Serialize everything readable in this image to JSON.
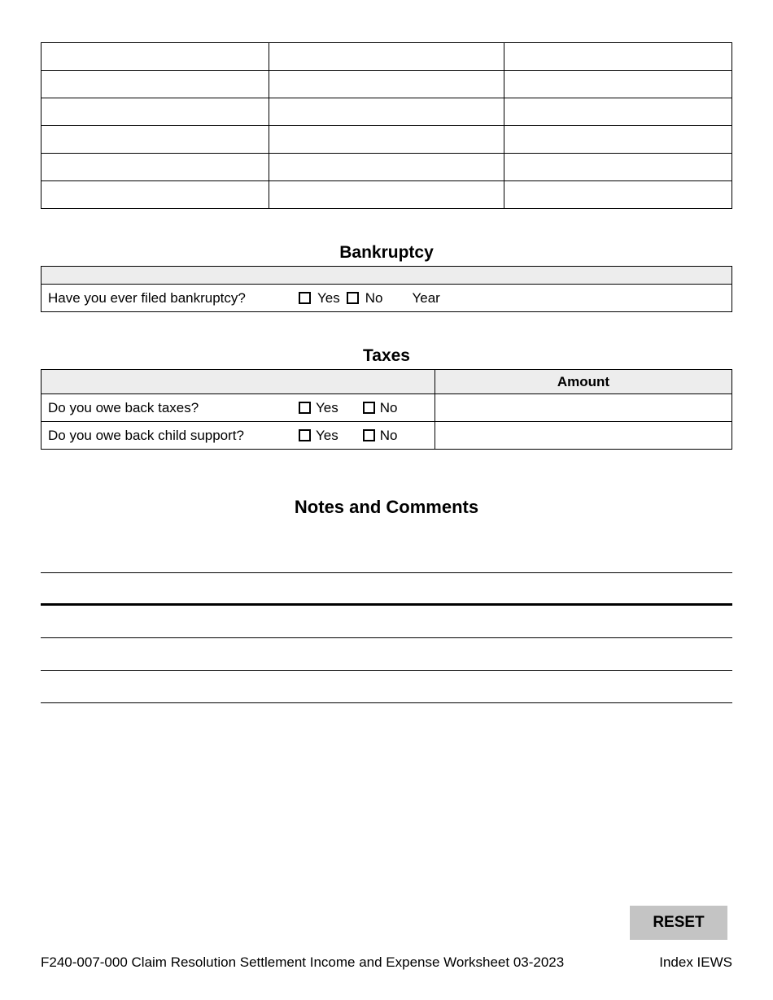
{
  "top_table": {
    "rows": 6,
    "cols": 3
  },
  "bankruptcy": {
    "title": "Bankruptcy",
    "question": "Have you ever filed bankruptcy?",
    "yes": "Yes",
    "no": "No",
    "year_label": "Year"
  },
  "taxes": {
    "title": "Taxes",
    "amount_header": "Amount",
    "rows": [
      {
        "question": "Do you owe back taxes?",
        "yes": "Yes",
        "no": "No"
      },
      {
        "question": "Do you owe back child support?",
        "yes": "Yes",
        "no": "No"
      }
    ]
  },
  "notes": {
    "title": "Notes and Comments",
    "line_count": 5
  },
  "reset_label": "RESET",
  "footer_left": "F240-007-000 Claim Resolution Settlement Income and Expense Worksheet  03-2023",
  "footer_right": "Index IEWS"
}
